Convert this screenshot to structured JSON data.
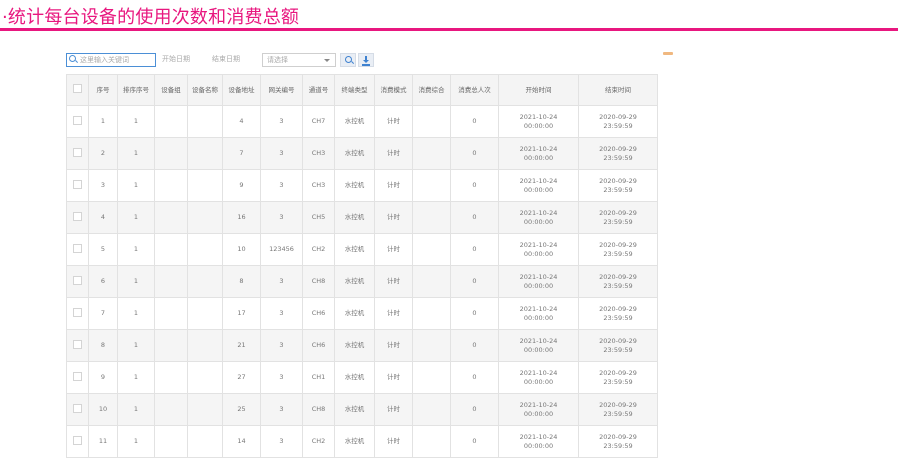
{
  "page": {
    "title": "·统计每台设备的使用次数和消费总额"
  },
  "toolbar": {
    "search_placeholder": "这里输入关键词",
    "start_date_placeholder": "开始日期",
    "end_date_placeholder": "结束日期",
    "select_value": "请选择",
    "search_icon": "search-icon",
    "export_icon": "download-icon"
  },
  "table": {
    "columns": [
      "序号",
      "排序序号",
      "设备组",
      "设备名称",
      "设备地址",
      "网关编号",
      "通道号",
      "终端类型",
      "消费模式",
      "消费综合",
      "消费总人次",
      "开始时间",
      "结束时间"
    ],
    "rows": [
      {
        "seq": "1",
        "sort": "1",
        "group": "",
        "name": "",
        "addr": "4",
        "gateway": "3",
        "channel": "CH7",
        "terminal": "水控机",
        "mode": "计时",
        "sum": "",
        "count": "0",
        "start_date": "2021-10-24",
        "start_time": "00:00:00",
        "end_date": "2020-09-29",
        "end_time": "23:59:59"
      },
      {
        "seq": "2",
        "sort": "1",
        "group": "",
        "name": "",
        "addr": "7",
        "gateway": "3",
        "channel": "CH3",
        "terminal": "水控机",
        "mode": "计时",
        "sum": "",
        "count": "0",
        "start_date": "2021-10-24",
        "start_time": "00:00:00",
        "end_date": "2020-09-29",
        "end_time": "23:59:59"
      },
      {
        "seq": "3",
        "sort": "1",
        "group": "",
        "name": "",
        "addr": "9",
        "gateway": "3",
        "channel": "CH3",
        "terminal": "水控机",
        "mode": "计时",
        "sum": "",
        "count": "0",
        "start_date": "2021-10-24",
        "start_time": "00:00:00",
        "end_date": "2020-09-29",
        "end_time": "23:59:59"
      },
      {
        "seq": "4",
        "sort": "1",
        "group": "",
        "name": "",
        "addr": "16",
        "gateway": "3",
        "channel": "CH5",
        "terminal": "水控机",
        "mode": "计时",
        "sum": "",
        "count": "0",
        "start_date": "2021-10-24",
        "start_time": "00:00:00",
        "end_date": "2020-09-29",
        "end_time": "23:59:59"
      },
      {
        "seq": "5",
        "sort": "1",
        "group": "",
        "name": "",
        "addr": "10",
        "gateway": "123456",
        "channel": "CH2",
        "terminal": "水控机",
        "mode": "计时",
        "sum": "",
        "count": "0",
        "start_date": "2021-10-24",
        "start_time": "00:00:00",
        "end_date": "2020-09-29",
        "end_time": "23:59:59"
      },
      {
        "seq": "6",
        "sort": "1",
        "group": "",
        "name": "",
        "addr": "8",
        "gateway": "3",
        "channel": "CH8",
        "terminal": "水控机",
        "mode": "计时",
        "sum": "",
        "count": "0",
        "start_date": "2021-10-24",
        "start_time": "00:00:00",
        "end_date": "2020-09-29",
        "end_time": "23:59:59"
      },
      {
        "seq": "7",
        "sort": "1",
        "group": "",
        "name": "",
        "addr": "17",
        "gateway": "3",
        "channel": "CH6",
        "terminal": "水控机",
        "mode": "计时",
        "sum": "",
        "count": "0",
        "start_date": "2021-10-24",
        "start_time": "00:00:00",
        "end_date": "2020-09-29",
        "end_time": "23:59:59"
      },
      {
        "seq": "8",
        "sort": "1",
        "group": "",
        "name": "",
        "addr": "21",
        "gateway": "3",
        "channel": "CH6",
        "terminal": "水控机",
        "mode": "计时",
        "sum": "",
        "count": "0",
        "start_date": "2021-10-24",
        "start_time": "00:00:00",
        "end_date": "2020-09-29",
        "end_time": "23:59:59"
      },
      {
        "seq": "9",
        "sort": "1",
        "group": "",
        "name": "",
        "addr": "27",
        "gateway": "3",
        "channel": "CH1",
        "terminal": "水控机",
        "mode": "计时",
        "sum": "",
        "count": "0",
        "start_date": "2021-10-24",
        "start_time": "00:00:00",
        "end_date": "2020-09-29",
        "end_time": "23:59:59"
      },
      {
        "seq": "10",
        "sort": "1",
        "group": "",
        "name": "",
        "addr": "25",
        "gateway": "3",
        "channel": "CH8",
        "terminal": "水控机",
        "mode": "计时",
        "sum": "",
        "count": "0",
        "start_date": "2021-10-24",
        "start_time": "00:00:00",
        "end_date": "2020-09-29",
        "end_time": "23:59:59"
      },
      {
        "seq": "11",
        "sort": "1",
        "group": "",
        "name": "",
        "addr": "14",
        "gateway": "3",
        "channel": "CH2",
        "terminal": "水控机",
        "mode": "计时",
        "sum": "",
        "count": "0",
        "start_date": "2021-10-24",
        "start_time": "00:00:00",
        "end_date": "2020-09-29",
        "end_time": "23:59:59"
      }
    ]
  },
  "colors": {
    "accent": "#e8177f",
    "link_blue": "#3f82d0",
    "header_bg": "#f4f4f4"
  }
}
